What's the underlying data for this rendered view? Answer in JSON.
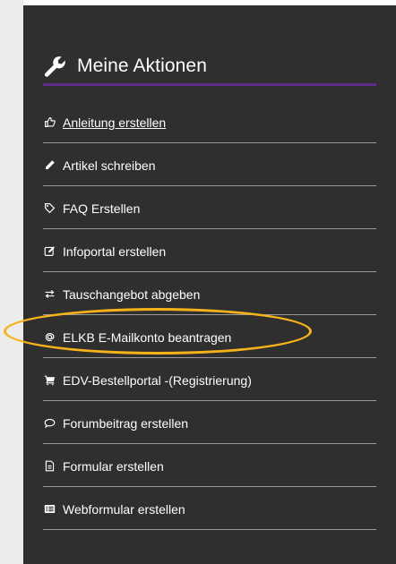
{
  "panel": {
    "title": "Meine Aktionen",
    "title_icon": "wrench-icon"
  },
  "menu": [
    {
      "label": "Anleitung erstellen",
      "icon": "thumbs-up-icon",
      "underlined": true
    },
    {
      "label": "Artikel schreiben",
      "icon": "pencil-icon"
    },
    {
      "label": "FAQ Erstellen",
      "icon": "tag-icon"
    },
    {
      "label": "Infoportal erstellen",
      "icon": "edit-icon"
    },
    {
      "label": "Tauschangebot abgeben",
      "icon": "exchange-icon"
    },
    {
      "label": "ELKB E-Mailkonto beantragen",
      "icon": "at-icon",
      "highlighted": true
    },
    {
      "label": "EDV-Bestellportal -(Registrierung)",
      "icon": "cart-icon"
    },
    {
      "label": "Forumbeitrag erstellen",
      "icon": "comments-icon"
    },
    {
      "label": "Formular erstellen",
      "icon": "file-text-icon"
    },
    {
      "label": "Webformular erstellen",
      "icon": "list-alt-icon"
    }
  ],
  "colors": {
    "panel_bg": "#2f2f2f",
    "title_underline": "#5b2d86",
    "highlight_ring": "#f6b21a",
    "divider": "#9a9a9a"
  }
}
